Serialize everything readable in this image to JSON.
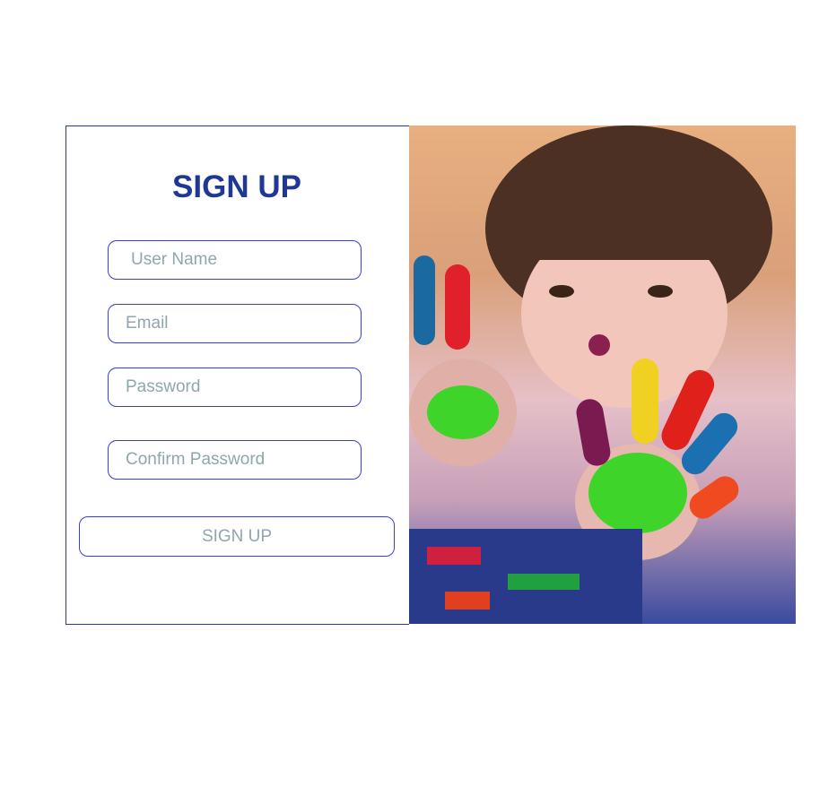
{
  "form": {
    "title": "SIGN UP",
    "fields": {
      "username": {
        "placeholder": "User Name"
      },
      "email": {
        "placeholder": "Email"
      },
      "password": {
        "placeholder": "Password"
      },
      "confirm_password": {
        "placeholder": "Confirm Password"
      }
    },
    "submit_label": "SIGN UP"
  },
  "colors": {
    "accent": "#1f3795",
    "border": "#3a3fd0",
    "placeholder": "#8fa6ad"
  }
}
